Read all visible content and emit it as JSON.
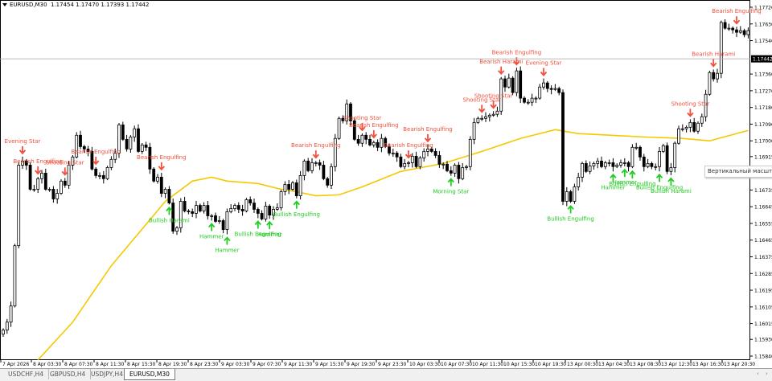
{
  "header": {
    "symbol": "EURUSD,M30",
    "ohlc": "1.17454 1.17470 1.17393 1.17442"
  },
  "tooltip": "Вертикальный масштаб",
  "tabs": [
    {
      "label": "USDCHF,H4",
      "active": false
    },
    {
      "label": "GBPUSD,H4",
      "active": false
    },
    {
      "label": "USDJPY,H4",
      "active": false
    },
    {
      "label": "EURUSD,M30",
      "active": true
    }
  ],
  "colors": {
    "bearish": "#f0503c",
    "bullish": "#22cc22",
    "ma": "#f5c800",
    "candle": "#000000"
  },
  "chart_data": {
    "type": "candlestick",
    "symbol": "EURUSD",
    "timeframe": "M30",
    "ylim": [
      1.1584,
      1.1772
    ],
    "current_price": "1.17442",
    "price_ticks": [
      "1.17720",
      "1.17630",
      "1.17540",
      "1.17360",
      "1.17270",
      "1.17180",
      "1.17090",
      "1.17000",
      "1.16915",
      "1.16735",
      "1.16645",
      "1.16555",
      "1.16465",
      "1.16375",
      "1.16285",
      "1.16195",
      "1.16105",
      "1.16015",
      "1.15930",
      "1.15840"
    ],
    "time_ticks": [
      "7 Apr 2026",
      "8 Apr 03:30",
      "8 Apr 07:30",
      "8 Apr 11:30",
      "8 Apr 15:30",
      "8 Apr 19:30",
      "8 Apr 23:30",
      "9 Apr 03:30",
      "9 Apr 07:30",
      "9 Apr 11:30",
      "9 Apr 15:30",
      "9 Apr 19:30",
      "9 Apr 23:30",
      "10 Apr 03:30",
      "10 Apr 07:30",
      "10 Apr 11:30",
      "10 Apr 15:30",
      "10 Apr 19:30",
      "13 Apr 00:30",
      "13 Apr 04:30",
      "13 Apr 08:30",
      "13 Apr 12:30",
      "13 Apr 16:30",
      "13 Apr 20:30"
    ],
    "first_open": 1.15958,
    "closes": [
      1.1598,
      1.16023,
      1.1611,
      1.16435,
      1.16869,
      1.16891,
      1.16869,
      1.16739,
      1.16739,
      1.16796,
      1.16826,
      1.16739,
      1.16739,
      1.16687,
      1.16717,
      1.16783,
      1.16761,
      1.16869,
      1.16913,
      1.1703,
      1.16969,
      1.16956,
      1.16943,
      1.16848,
      1.16813,
      1.16813,
      1.16796,
      1.16856,
      1.169,
      1.16934,
      1.17086,
      1.17008,
      1.16956,
      1.17021,
      1.17065,
      1.16943,
      1.16978,
      1.16965,
      1.16848,
      1.16783,
      1.16804,
      1.16717,
      1.16739,
      1.16665,
      1.16513,
      1.16531,
      1.16674,
      1.16622,
      1.16618,
      1.16609,
      1.16652,
      1.16622,
      1.16652,
      1.16596,
      1.16596,
      1.16566,
      1.1657,
      1.16522,
      1.16618,
      1.16635,
      1.16652,
      1.16631,
      1.16622,
      1.16683,
      1.16665,
      1.16631,
      1.16609,
      1.16579,
      1.16648,
      1.166,
      1.16631,
      1.16639,
      1.16726,
      1.16765,
      1.16739,
      1.16774,
      1.16704,
      1.16813,
      1.16891,
      1.16839,
      1.16882,
      1.16882,
      1.16869,
      1.16796,
      1.16761,
      1.16861,
      1.17013,
      1.17121,
      1.17108,
      1.17199,
      1.17108,
      1.17008,
      1.16987,
      1.1703,
      1.17008,
      1.16978,
      1.16991,
      1.16965,
      1.17013,
      1.16969,
      1.16934,
      1.16934,
      1.16913,
      1.16861,
      1.16878,
      1.16882,
      1.16917,
      1.16861,
      1.16908,
      1.16943,
      1.16956,
      1.16943,
      1.16921,
      1.16874,
      1.16874,
      1.16839,
      1.16826,
      1.16869,
      1.16796,
      1.16856,
      1.16861,
      1.17008,
      1.17099,
      1.17121,
      1.17121,
      1.1713,
      1.17138,
      1.17143,
      1.1716,
      1.17334,
      1.1729,
      1.17338,
      1.1726,
      1.17377,
      1.1723,
      1.17208,
      1.17208,
      1.1723,
      1.1723,
      1.1729,
      1.17312,
      1.17282,
      1.17277,
      1.17282,
      1.1726,
      1.16674,
      1.16726,
      1.16674,
      1.16752,
      1.16804,
      1.16878,
      1.16835,
      1.16865,
      1.16878,
      1.16891,
      1.16861,
      1.16882,
      1.16882,
      1.16861,
      1.16869,
      1.16882,
      1.16882,
      1.16861,
      1.16965,
      1.16965,
      1.16913,
      1.16861,
      1.16878,
      1.16861,
      1.16861,
      1.16943,
      1.16974,
      1.16835,
      1.16856,
      1.16987,
      1.17065,
      1.17065,
      1.17073,
      1.17099,
      1.17052,
      1.17095,
      1.1713,
      1.17251,
      1.17368,
      1.17334,
      1.17364,
      1.17638,
      1.17607,
      1.17607,
      1.17598,
      1.17585,
      1.17594,
      1.17572,
      1.17594
    ],
    "moving_average": [
      [
        9,
        1.15819
      ],
      [
        18,
        1.16023
      ],
      [
        28,
        1.16327
      ],
      [
        35,
        1.165
      ],
      [
        42,
        1.16674
      ],
      [
        49,
        1.16783
      ],
      [
        54,
        1.16804
      ],
      [
        58,
        1.16783
      ],
      [
        66,
        1.1677
      ],
      [
        72,
        1.16739
      ],
      [
        76,
        1.16726
      ],
      [
        81,
        1.16704
      ],
      [
        87,
        1.16709
      ],
      [
        93,
        1.16752
      ],
      [
        103,
        1.16835
      ],
      [
        114,
        1.16878
      ],
      [
        124,
        1.16943
      ],
      [
        134,
        1.17013
      ],
      [
        143,
        1.1706
      ],
      [
        149,
        1.17039
      ],
      [
        166,
        1.17021
      ],
      [
        176,
        1.17013
      ],
      [
        183,
        1.17
      ],
      [
        193,
        1.17056
      ]
    ],
    "patterns": [
      {
        "label": "Evening Star",
        "type": "bearish",
        "candle": 5
      },
      {
        "label": "Bearish Engulfing",
        "type": "bearish",
        "candle": 9
      },
      {
        "label": "Shooting Star",
        "type": "bearish",
        "candle": 16
      },
      {
        "label": "Bearish Engulfing",
        "type": "bearish",
        "candle": 24
      },
      {
        "label": "Bearish Engulfing",
        "type": "bearish",
        "candle": 41
      },
      {
        "label": "Bullish Harami",
        "type": "bullish",
        "candle": 43
      },
      {
        "label": "Hammer",
        "type": "bullish",
        "candle": 54
      },
      {
        "label": "Hammer",
        "type": "bullish",
        "candle": 58
      },
      {
        "label": "Bullish Engulfing",
        "type": "bullish",
        "candle": 66
      },
      {
        "label": "Hammer",
        "type": "bullish",
        "candle": 69
      },
      {
        "label": "Bullish Engulfing",
        "type": "bullish",
        "candle": 76
      },
      {
        "label": "Bearish Engulfing",
        "type": "bearish",
        "candle": 81
      },
      {
        "label": "Shooting Star",
        "type": "bearish",
        "candle": 93
      },
      {
        "label": "Bearish Engulfing",
        "type": "bearish",
        "candle": 96
      },
      {
        "label": "Bearish Engulfing",
        "type": "bearish",
        "candle": 105
      },
      {
        "label": "Bearish Engulfing",
        "type": "bearish",
        "candle": 110
      },
      {
        "label": "Morning Star",
        "type": "bullish",
        "candle": 116
      },
      {
        "label": "Shooting Star",
        "type": "bearish",
        "candle": 124
      },
      {
        "label": "Shooting Star",
        "type": "bearish",
        "candle": 127
      },
      {
        "label": "Bearish Harami",
        "type": "bearish",
        "candle": 129
      },
      {
        "label": "Bearish Engulfing",
        "type": "bearish",
        "candle": 133
      },
      {
        "label": "Evening Star",
        "type": "bearish",
        "candle": 140
      },
      {
        "label": "Bullish Engulfing",
        "type": "bullish",
        "candle": 147
      },
      {
        "label": "Hammer",
        "type": "bullish",
        "candle": 158
      },
      {
        "label": "Hammer",
        "type": "bullish",
        "candle": 161
      },
      {
        "label": "Bullish Engulfing",
        "type": "bullish",
        "candle": 163
      },
      {
        "label": "Bullish Engulfing",
        "type": "bullish",
        "candle": 170
      },
      {
        "label": "Bullish Harami",
        "type": "bullish",
        "candle": 173
      },
      {
        "label": "Shooting Star",
        "type": "bearish",
        "candle": 178
      },
      {
        "label": "Bearish Harami",
        "type": "bearish",
        "candle": 184
      },
      {
        "label": "Bearish Engulfing",
        "type": "bearish",
        "candle": 190
      }
    ]
  }
}
